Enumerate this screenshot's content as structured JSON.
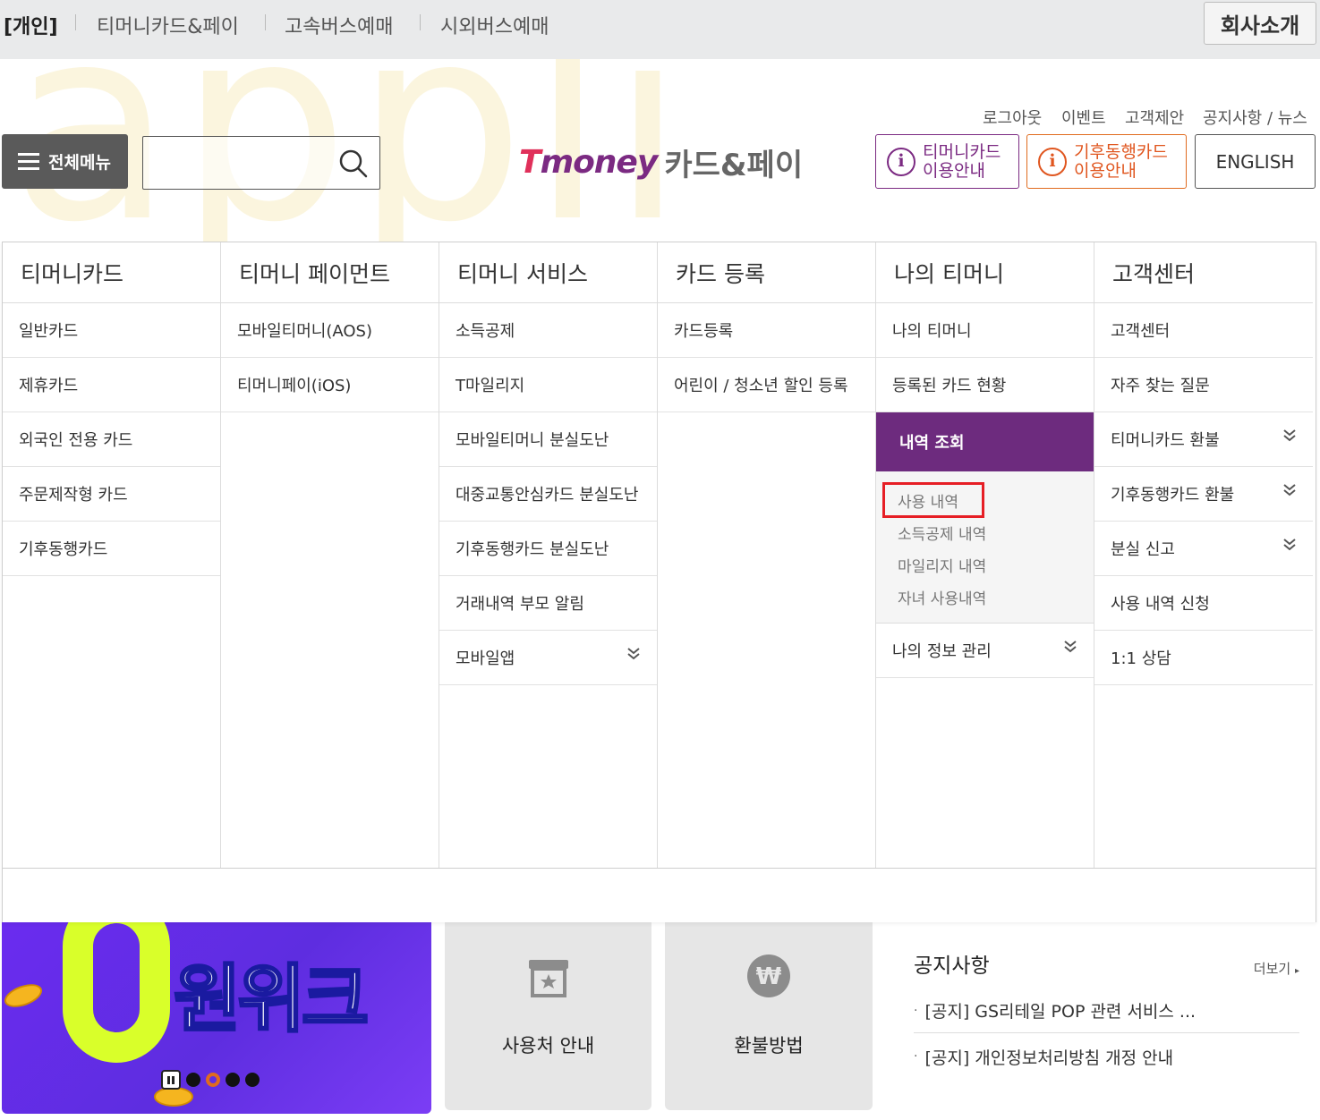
{
  "watermark": "appli",
  "topbar": {
    "items": [
      "[개인]",
      "티머니카드&페이",
      "고속버스예매",
      "시외버스예매"
    ],
    "company_button": "회사소개"
  },
  "util_links": [
    "로그아웃",
    "이벤트",
    "고객제안",
    "공지사항 / 뉴스"
  ],
  "header": {
    "menu_button": "전체메뉴",
    "search": {
      "value": "",
      "placeholder": ""
    },
    "logo_brand": "money",
    "logo_brand_initial": "T",
    "logo_suffix": "카드&페이",
    "tmoney_card_guide": [
      "티머니카드",
      "이용안내"
    ],
    "climate_card_guide": [
      "기후동행카드",
      "이용안내"
    ],
    "english_button": "ENGLISH"
  },
  "mega_menu": {
    "columns": [
      {
        "title": "티머니카드",
        "items": [
          "일반카드",
          "제휴카드",
          "외국인 전용 카드",
          "주문제작형 카드",
          "기후동행카드"
        ]
      },
      {
        "title": "티머니 페이먼트",
        "items": [
          "모바일티머니(AOS)",
          "티머니페이(iOS)"
        ]
      },
      {
        "title": "티머니 서비스",
        "items": [
          "소득공제",
          "T마일리지",
          "모바일티머니 분실도난",
          "대중교통안심카드 분실도난",
          "기후동행카드 분실도난",
          "거래내역 부모 알림",
          "모바일앱"
        ]
      },
      {
        "title": "카드 등록",
        "items": [
          "카드등록",
          "어린이 / 청소년 할인 등록"
        ]
      },
      {
        "title": "나의 티머니",
        "items": [
          "나의 티머니",
          "등록된 카드 현황",
          "내역 조회"
        ],
        "active_item": "내역 조회",
        "sub_items": [
          "사용 내역",
          "소득공제 내역",
          "마일리지 내역",
          "자녀 사용내역"
        ],
        "after_items": [
          "나의 정보 관리"
        ]
      },
      {
        "title": "고객센터",
        "items": [
          "고객센터",
          "자주 찾는 질문",
          "티머니카드 환불",
          "기후동행카드 환불",
          "분실 신고",
          "사용 내역 신청",
          "1:1 상담"
        ]
      }
    ]
  },
  "tiles": {
    "store_label": "사용처 안내",
    "refund_label": "환불방법"
  },
  "banner": {
    "text": "원위크"
  },
  "notice": {
    "title": "공지사항",
    "more": "더보기",
    "rows": [
      "[공지] GS리테일 POP 관련 서비스 ...",
      "[공지] 개인정보처리방침 개정 안내"
    ]
  },
  "colors": {
    "brand_purple": "#6d2b7e",
    "climate_orange": "#e0561f",
    "highlight_red": "#e61e25"
  }
}
